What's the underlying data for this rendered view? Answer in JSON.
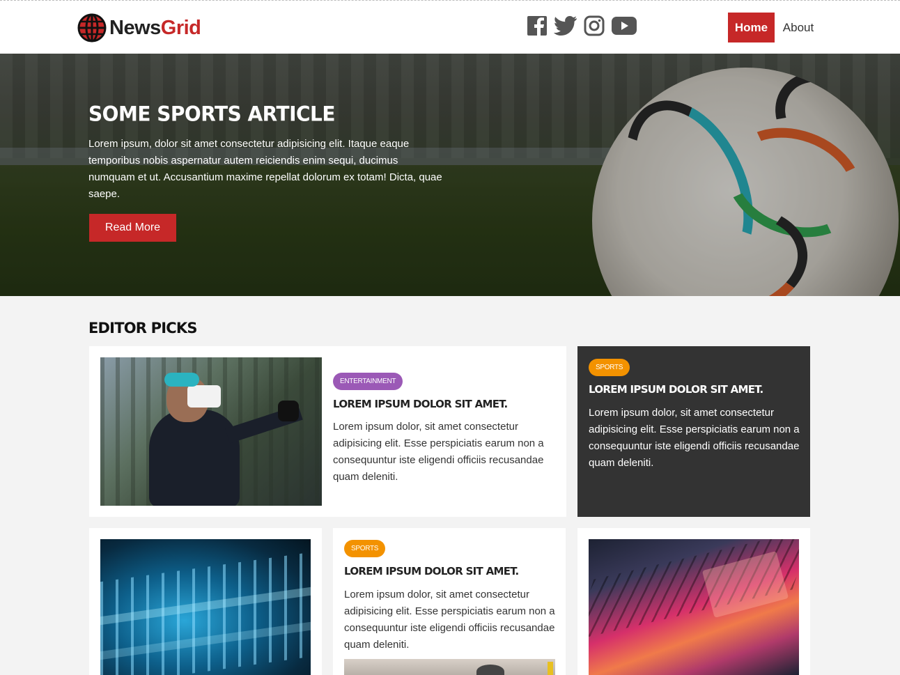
{
  "header": {
    "logo_main": "News",
    "logo_accent": "Grid",
    "social_icons": [
      "facebook-icon",
      "twitter-icon",
      "instagram-icon",
      "youtube-icon"
    ],
    "nav": {
      "home": "Home",
      "about": "About"
    },
    "colors": {
      "accent": "#c62828"
    }
  },
  "hero": {
    "title": "Some Sports Article",
    "text": "Lorem ipsum, dolor sit amet consectetur adipisicing elit. Itaque eaque temporibus nobis aspernatur autem reiciendis enim sequi, ducimus numquam et ut. Accusantium maxime repellat dolorum ex totam! Dicta, quae saepe.",
    "button": "Read More"
  },
  "editor_picks": {
    "title": "Editor Picks",
    "cards": [
      {
        "tag": "Entertainment",
        "title": "Lorem ipsum dolor sit amet.",
        "text": "Lorem ipsum dolor, sit amet consectetur adipisicing elit. Esse perspiciatis earum non a consequuntur iste eligendi officiis recusandae quam deleniti."
      },
      {
        "tag": "Sports",
        "title": "Lorem ipsum dolor sit amet.",
        "text": "Lorem ipsum dolor, sit amet consectetur adipisicing elit. Esse perspiciatis earum non a consequuntur iste eligendi officiis recusandae quam deleniti."
      },
      {
        "tag": "Sports",
        "title": "Lorem ipsum dolor sit amet.",
        "text": "Lorem ipsum dolor, sit amet consectetur adipisicing elit. Esse perspiciatis earum non a consequuntur iste eligendi officiis recusandae quam deleniti."
      }
    ],
    "colors": {
      "entertainment": "#9b59b6",
      "sports": "#f39200",
      "dark_card": "#333333"
    }
  }
}
